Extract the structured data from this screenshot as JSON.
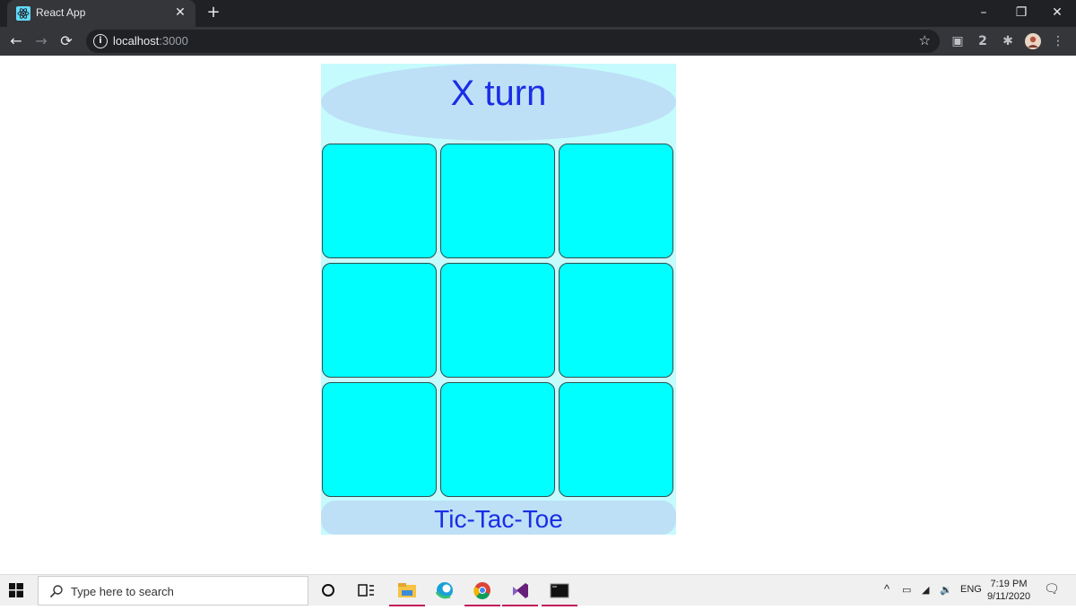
{
  "browser": {
    "tab_title": "React App",
    "url_host": "localhost",
    "url_port": ":3000",
    "extension_badge": "2"
  },
  "game": {
    "status": "X turn",
    "title": "Tic-Tac-Toe",
    "cells": [
      "",
      "",
      "",
      "",
      "",
      "",
      "",
      "",
      ""
    ]
  },
  "taskbar": {
    "search_placeholder": "Type here to search",
    "language": "ENG",
    "time": "7:19 PM",
    "date": "9/11/2020"
  },
  "colors": {
    "cell_fill": "#00ffff",
    "status_bg": "#bde0f6",
    "text_accent": "#1a2de6",
    "game_bg": "#c5fbfd"
  }
}
